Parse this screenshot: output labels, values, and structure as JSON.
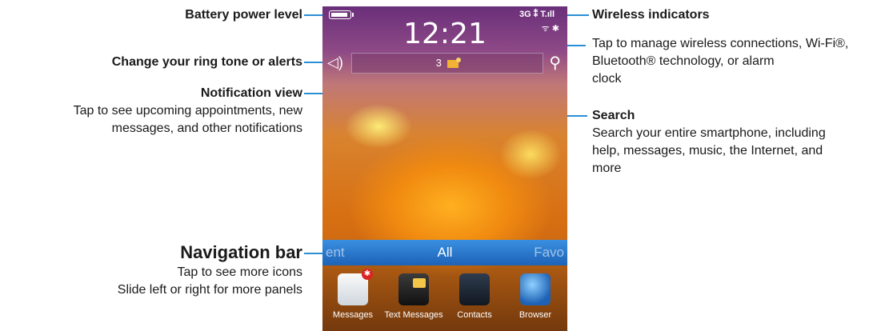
{
  "phone": {
    "clock": "12:21",
    "network": "3G ⁑ T.ıll",
    "wifi_bt": "ᯤ ✱",
    "notification_count": "3",
    "battery_level": 0.9,
    "navbar": {
      "left": "ent",
      "center": "All",
      "right": "Favo"
    },
    "apps": [
      {
        "label": "Messages"
      },
      {
        "label": "Text Messages"
      },
      {
        "label": "Contacts"
      },
      {
        "label": "Browser"
      }
    ]
  },
  "annotations": {
    "battery": "Battery power level",
    "ringtone": "Change your ring tone or alerts",
    "notification_title": "Notification view",
    "notification_desc_1": "Tap to see upcoming appointments, new",
    "notification_desc_2": "messages, and other notifications",
    "navbar_title": "Navigation bar",
    "navbar_desc_1": "Tap to see more icons",
    "navbar_desc_2": "Slide left or right for more panels",
    "wireless_title": "Wireless indicators",
    "wireless_desc_1": "Tap to manage wireless connections, Wi-Fi®,",
    "wireless_desc_2": "Bluetooth® technology, or alarm",
    "wireless_desc_3": "clock",
    "search_title": "Search",
    "search_desc_1": "Search your entire smartphone, including",
    "search_desc_2": "help, messages, music, the Internet, and",
    "search_desc_3": "more"
  },
  "colors": {
    "callout_line": "#2a8fd6",
    "navbar": "#2a7fd3"
  }
}
